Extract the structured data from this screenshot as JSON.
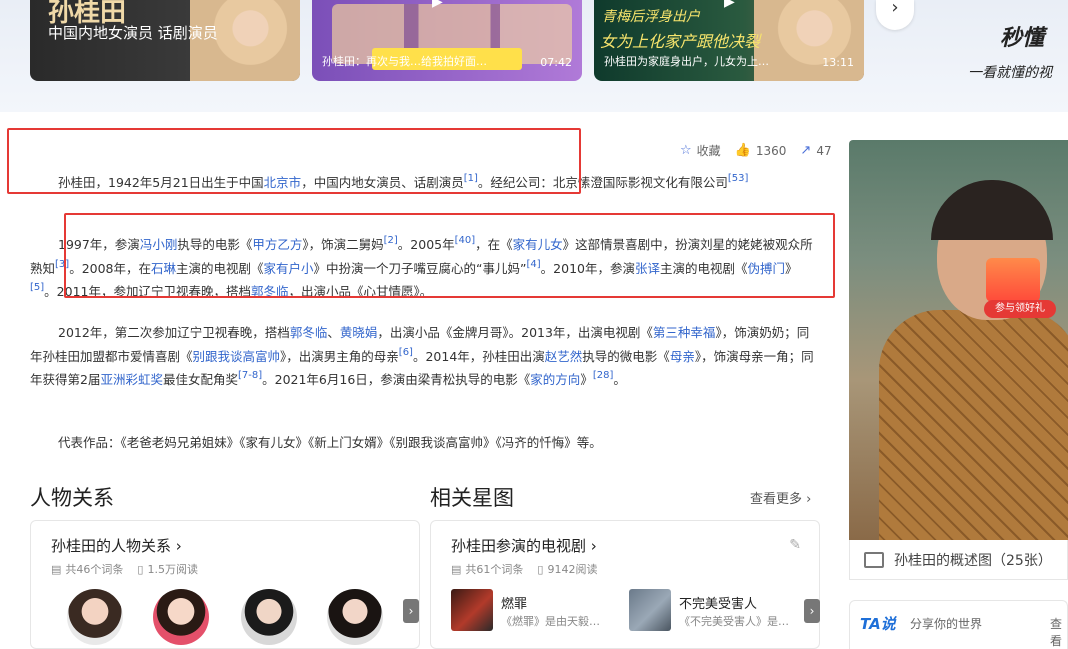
{
  "videos": [
    {
      "big_name": "孙桂田",
      "subtitle": "中国内地女演员 话剧演员"
    },
    {
      "caption": "孙桂田：再次与我…给我拍好面…",
      "duration": "07:42"
    },
    {
      "calligraphy_1": "青梅后浮身出户",
      "calligraphy_2": "女为上化家产跟他决裂",
      "caption": "孙桂田为家庭身出户，儿女为上…",
      "duration": "13:11"
    }
  ],
  "brand": {
    "logo": "秒懂",
    "slogan": "一看就懂的视"
  },
  "actions": {
    "collect": "收藏",
    "likes": "1360",
    "shares": "47"
  },
  "intro": {
    "p1_a": "孙桂田，1942年5月21日出生于中国",
    "p1_link": "北京市",
    "p1_b": "，中国内地女演员、话剧演员",
    "p1_ref1": "[1]",
    "p1_c": "。经纪公司：北京愫澄国际影视文化有限公司",
    "p1_ref2": "[53]",
    "p2_a": "1997年，参演",
    "p2_l1": "冯小刚",
    "p2_b": "执导的电影《",
    "p2_l2": "甲方乙方",
    "p2_c": "》，饰演二舅妈",
    "p2_r1": "[2]",
    "p2_d": "。2005年",
    "p2_r2": "[40]",
    "p2_e": "，在《",
    "p2_l3": "家有儿女",
    "p2_f": "》这部情景喜剧中，扮演刘星的姥姥被观众所熟知",
    "p2_r3": "[3]",
    "p2_g": "。2008年，在",
    "p2_l4": "石琳",
    "p2_h": "主演的电视剧《",
    "p2_l5": "家有户小",
    "p2_i": "》中扮演一个刀子嘴豆腐心的“事儿妈”",
    "p2_r4": "[4]",
    "p2_j": "。2010年，参演",
    "p2_l6": "张译",
    "p2_k": "主演的电视剧《",
    "p2_l7": "伪搏门",
    "p2_l": "》",
    "p2_r5": "[5]",
    "p2_m": "。2011年，参加辽宁卫视春晚，搭档",
    "p2_l8": "郭冬临",
    "p2_n": "，出演小品《心甘情愿》。",
    "p3_a": "2012年，第二次参加辽宁卫视春晚，搭档",
    "p3_l1": "郭冬临",
    "p3_b": "、",
    "p3_l2": "黄晓娟",
    "p3_c": "，出演小品《金牌月哥》。2013年，出演电视剧《",
    "p3_l3": "第三种幸福",
    "p3_d": "》，饰演奶奶；同年孙桂田加盟都市爱情喜剧《",
    "p3_l4": "别跟我谈高富帅",
    "p3_e": "》，出演男主角的母亲",
    "p3_r1": "[6]",
    "p3_f": "。2014年，孙桂田出演",
    "p3_l5": "赵艺然",
    "p3_g": "执导的微电影《",
    "p3_l6": "母亲",
    "p3_h": "》，饰演母亲一角；同年获得第2届",
    "p3_l7": "亚洲彩虹奖",
    "p3_i": "最佳女配角奖",
    "p3_r2": "[7-8]",
    "p3_j": "。2021年6月16日，参演由梁青松执导的电影《",
    "p3_l8": "家的方向",
    "p3_k": "》",
    "p3_r3": "[28]",
    "p3_l": "。",
    "p4": "代表作品：《老爸老妈兄弟姐妹》《家有儿女》《新上门女婿》《别跟我谈高富帅》《冯齐的忏悔》等。"
  },
  "relations": {
    "section_title": "人物关系",
    "panel_title": "孙桂田的人物关系",
    "entries": "共46个词条",
    "reads": "1.5万阅读"
  },
  "stars": {
    "section_title": "相关星图",
    "more": "查看更多",
    "panel_title": "孙桂田参演的电视剧",
    "entries": "共61个词条",
    "reads": "9142阅读",
    "dramas": [
      {
        "title": "燃罪",
        "desc": "《燃罪》是由天毅…"
      },
      {
        "title": "不完美受害人",
        "desc": "《不完美受害人》是…"
      }
    ]
  },
  "sidebar": {
    "gift_label": "参与领好礼",
    "overview": "孙桂田的概述图（25张）",
    "ta_logo": "TA说",
    "ta_sub": "分享你的世界",
    "ta_more": "查看"
  }
}
